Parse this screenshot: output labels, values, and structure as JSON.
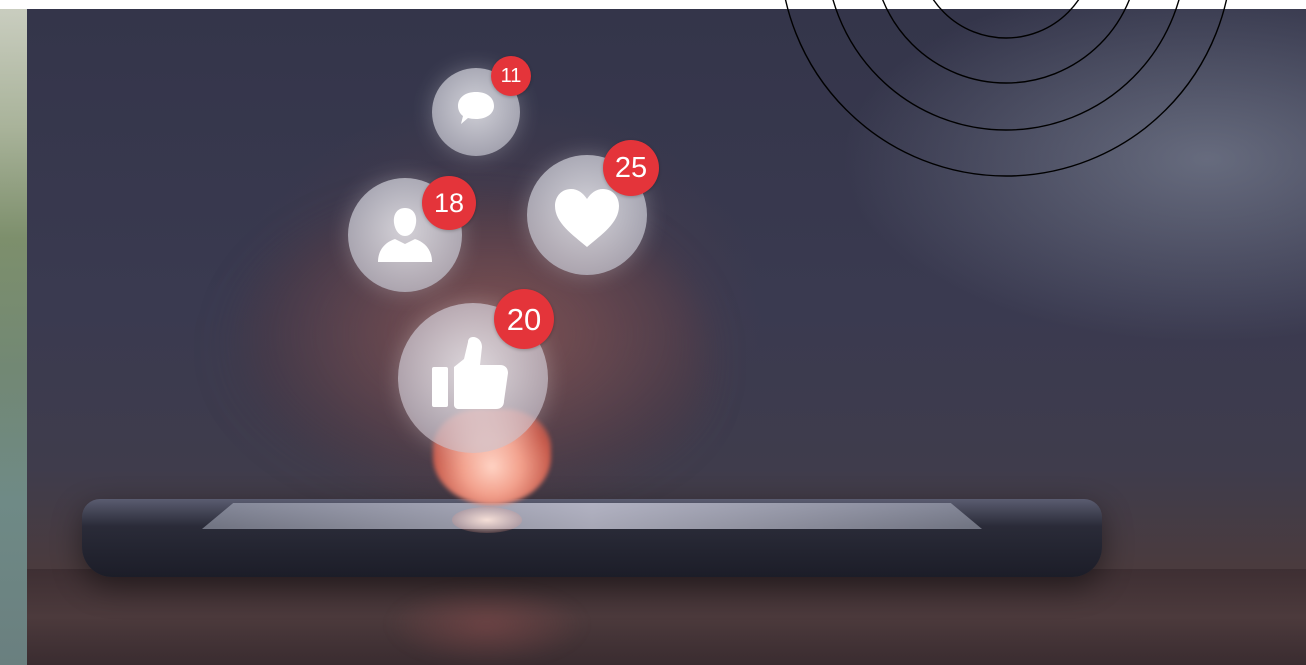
{
  "notifications": {
    "comments": {
      "icon": "speech-bubble-icon",
      "count": "11"
    },
    "followers": {
      "icon": "user-icon",
      "count": "18"
    },
    "likes": {
      "icon": "thumbs-up-icon",
      "count": "20"
    },
    "hearts": {
      "icon": "heart-icon",
      "count": "25"
    }
  },
  "colors": {
    "badge": "#e4343a",
    "bubble": "#d9d9e0",
    "rings": "#000000"
  }
}
